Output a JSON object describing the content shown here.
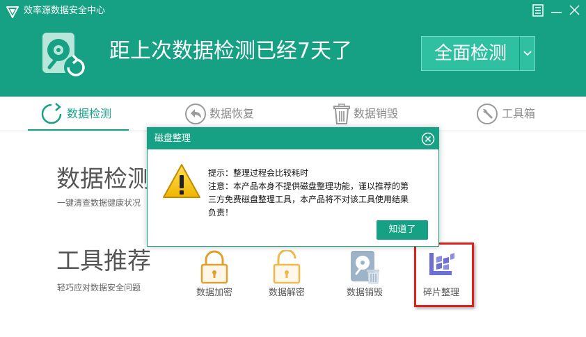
{
  "window": {
    "title": "效率源数据安全中心",
    "controls": [
      "menu-icon",
      "minimize-icon",
      "close-icon"
    ]
  },
  "header": {
    "headline": "距上次数据检测已经7天了",
    "scan_button": "全面检测"
  },
  "tabs": [
    {
      "label": "数据检测",
      "icon": "refresh-circle-icon",
      "active": true
    },
    {
      "label": "数据恢复",
      "icon": "undo-arrow-icon",
      "active": false
    },
    {
      "label": "数据销毁",
      "icon": "trash-icon",
      "active": false
    },
    {
      "label": "工具箱",
      "icon": "wrench-icon",
      "active": false
    }
  ],
  "detect_section": {
    "title": "数据检测",
    "subtitle": "一键清查数据健康状况"
  },
  "tools_section": {
    "title": "工具推荐",
    "subtitle": "轻巧应对数据安全问题",
    "items": [
      {
        "label": "数据加密",
        "icon": "lock-closed-icon"
      },
      {
        "label": "数据解密",
        "icon": "lock-open-icon"
      },
      {
        "label": "数据销毁",
        "icon": "disk-shred-icon"
      },
      {
        "label": "碎片整理",
        "icon": "defrag-icon"
      }
    ]
  },
  "dialog": {
    "title": "磁盘整理",
    "line1": "提示：整理过程会比较耗时",
    "line2": "注意：本产品本身不提供磁盘整理功能，谨以推荐的第",
    "line3": "三方免费磁盘整理工具，本产品将不对该工具使用结果",
    "line4": "负责！",
    "ok_button": "知道了"
  },
  "colors": {
    "brand": "#16a185",
    "brand_light": "#2fc0a1",
    "highlight": "#e0201c"
  }
}
